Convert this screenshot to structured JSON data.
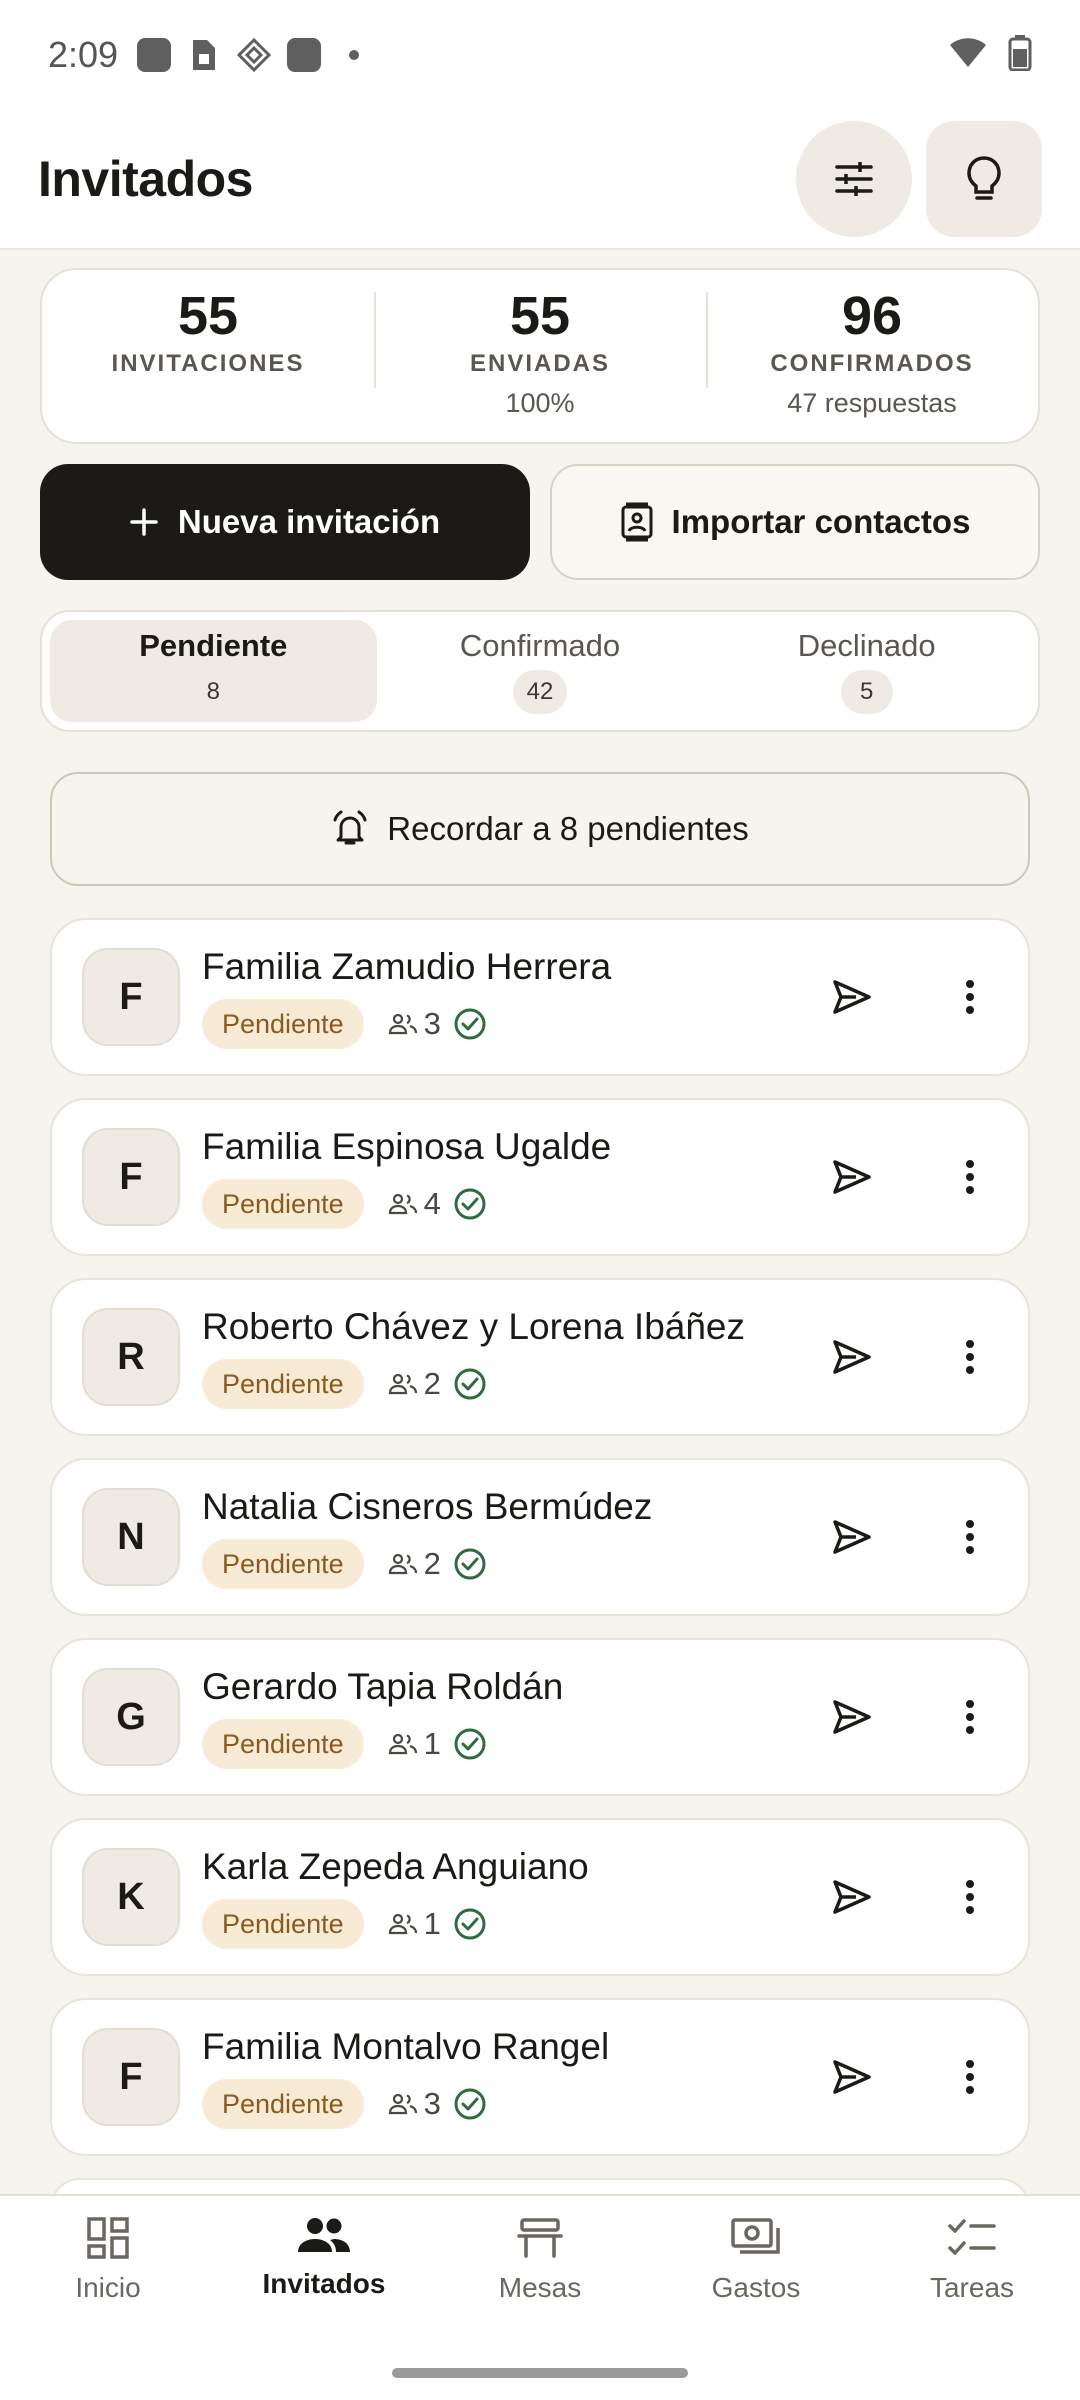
{
  "status_bar": {
    "time": "2:09"
  },
  "header": {
    "title": "Invitados"
  },
  "stats": [
    {
      "value": "55",
      "label": "INVITACIONES",
      "sub": ""
    },
    {
      "value": "55",
      "label": "ENVIADAS",
      "sub": "100%"
    },
    {
      "value": "96",
      "label": "CONFIRMADOS",
      "sub": "47 respuestas"
    }
  ],
  "actions": {
    "new_invitation": "Nueva invitación",
    "import_contacts": "Importar contactos"
  },
  "tabs": [
    {
      "label": "Pendiente",
      "count": "8",
      "active": true
    },
    {
      "label": "Confirmado",
      "count": "42",
      "active": false
    },
    {
      "label": "Declinado",
      "count": "5",
      "active": false
    }
  ],
  "reminder": {
    "label": "Recordar a 8 pendientes"
  },
  "guests": [
    {
      "initial": "F",
      "name": "Familia Zamudio Herrera",
      "status": "Pendiente",
      "people": "3"
    },
    {
      "initial": "F",
      "name": "Familia Espinosa Ugalde",
      "status": "Pendiente",
      "people": "4"
    },
    {
      "initial": "R",
      "name": "Roberto Chávez y Lorena Ibáñez",
      "status": "Pendiente",
      "people": "2"
    },
    {
      "initial": "N",
      "name": "Natalia Cisneros Bermúdez",
      "status": "Pendiente",
      "people": "2"
    },
    {
      "initial": "G",
      "name": "Gerardo Tapia Roldán",
      "status": "Pendiente",
      "people": "1"
    },
    {
      "initial": "K",
      "name": "Karla Zepeda Anguiano",
      "status": "Pendiente",
      "people": "1"
    },
    {
      "initial": "F",
      "name": "Familia Montalvo Rangel",
      "status": "Pendiente",
      "people": "3"
    }
  ],
  "nav": [
    {
      "label": "Inicio",
      "icon": "dashboard-icon",
      "active": false
    },
    {
      "label": "Invitados",
      "icon": "people-icon",
      "active": true
    },
    {
      "label": "Mesas",
      "icon": "table-icon",
      "active": false
    },
    {
      "label": "Gastos",
      "icon": "payments-icon",
      "active": false
    },
    {
      "label": "Tareas",
      "icon": "checklist-icon",
      "active": false
    }
  ],
  "colors": {
    "background": "#f6f4ef",
    "primary": "#1c1a17",
    "pending_badge_bg": "#f8ebd6",
    "pending_badge_text": "#8a5a1e",
    "confirmed_check": "#2e6b3e"
  }
}
